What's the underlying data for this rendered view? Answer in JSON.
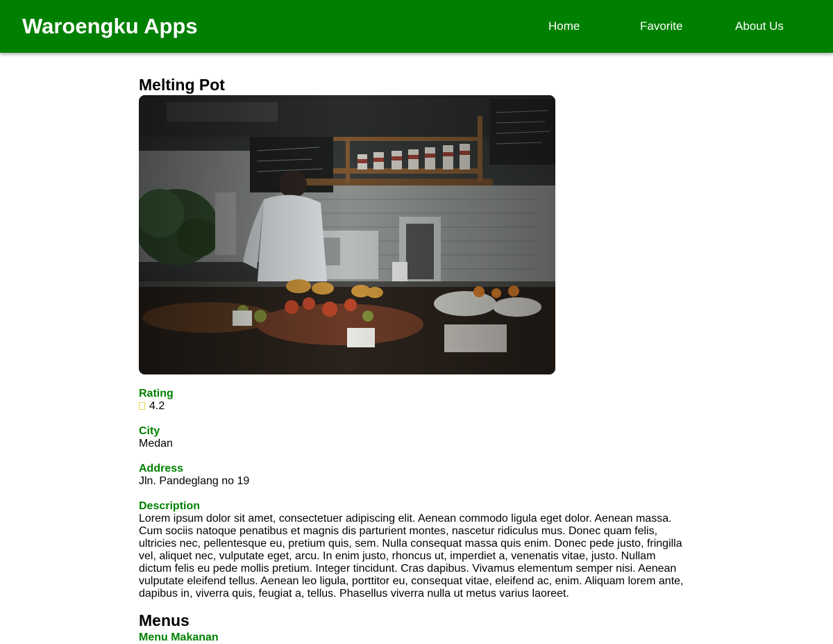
{
  "header": {
    "brand": "Waroengku Apps",
    "nav": [
      {
        "label": "Home"
      },
      {
        "label": "Favorite"
      },
      {
        "label": "About Us"
      }
    ]
  },
  "restaurant": {
    "name": "Melting Pot",
    "photo_description": "cafe-kitchen-counter-photo",
    "rating_label": "Rating",
    "rating_icon": "star-icon",
    "rating_value": "4.2",
    "city_label": "City",
    "city": "Medan",
    "address_label": "Address",
    "address": "Jln. Pandeglang no 19",
    "description_label": "Description",
    "description": "Lorem ipsum dolor sit amet, consectetuer adipiscing elit. Aenean commodo ligula eget dolor. Aenean massa. Cum sociis natoque penatibus et magnis dis parturient montes, nascetur ridiculus mus. Donec quam felis, ultricies nec, pellentesque eu, pretium quis, sem. Nulla consequat massa quis enim. Donec pede justo, fringilla vel, aliquet nec, vulputate eget, arcu. In enim justo, rhoncus ut, imperdiet a, venenatis vitae, justo. Nullam dictum felis eu pede mollis pretium. Integer tincidunt. Cras dapibus. Vivamus elementum semper nisi. Aenean vulputate eleifend tellus. Aenean leo ligula, porttitor eu, consequat vitae, eleifend ac, enim. Aliquam lorem ante, dapibus in, viverra quis, feugiat a, tellus. Phasellus viverra nulla ut metus varius laoreet."
  },
  "menus": {
    "title": "Menus",
    "subtitle": "Menu Makanan"
  },
  "colors": {
    "primary": "#008000",
    "header_text": "#ffffff",
    "rating_star": "#e8d84a"
  }
}
